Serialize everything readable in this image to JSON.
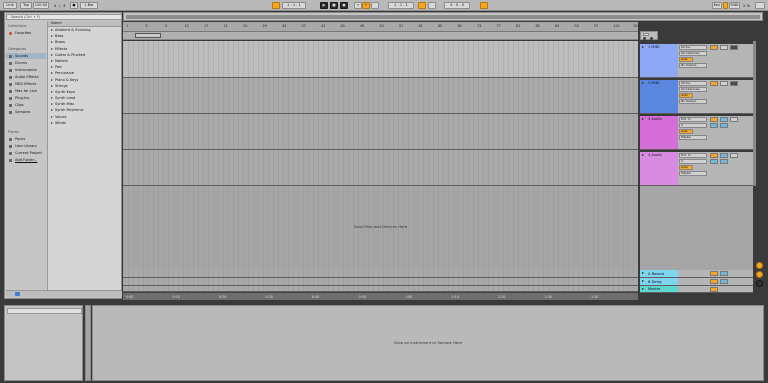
{
  "transport": {
    "link": "Link",
    "tap": "Tap",
    "tempo": "120.00",
    "meter_num": "4",
    "meter_den": "4",
    "metro": "1 Bar",
    "position": "1 . 1 . 1",
    "loop_start": "1 . 1 . 1",
    "loop_len": "4 . 0 . 0",
    "key": "Key",
    "midi": "MIDI",
    "cpu": "2 %",
    "accent": "#f5a623"
  },
  "browser": {
    "search_placeholder": "Search (Ctrl + F)",
    "collections_label": "Collections",
    "favorites": "Favorites",
    "categories_label": "Categories",
    "categories": [
      "Sounds",
      "Drums",
      "Instruments",
      "Audio Effects",
      "MIDI Effects",
      "Max for Live",
      "Plug-Ins",
      "Clips",
      "Samples"
    ],
    "places_label": "Places",
    "places": [
      "Packs",
      "User Library",
      "Current Project",
      "Add Folder..."
    ],
    "list_header": "Name",
    "items": [
      "Ambient & Evolving",
      "Bass",
      "Brass",
      "Effects",
      "Guitar & Plucked",
      "Mallets",
      "Pad",
      "Percussive",
      "Piano & Keys",
      "Strings",
      "Synth Keys",
      "Synth Lead",
      "Synth Misc",
      "Synth Rhythmic",
      "Voices",
      "Winds"
    ]
  },
  "ruler": {
    "bars": [
      "1",
      "5",
      "9",
      "13",
      "17",
      "21",
      "25",
      "29",
      "33",
      "37",
      "41",
      "45",
      "49",
      "53",
      "57",
      "61",
      "65",
      "69",
      "73",
      "77",
      "81",
      "85",
      "89",
      "93",
      "97",
      "101",
      "105"
    ]
  },
  "arrangement": {
    "drop_text": "Drop Files and Devices Here"
  },
  "tracks": [
    {
      "name": "1 MIDI",
      "color": "#8fa8f5",
      "io1": "All Ins",
      "io2": "All Channels",
      "io3": "Auto",
      "io4": "No Output"
    },
    {
      "name": "2 MIDI",
      "color": "#5a86e0",
      "io1": "All Ins",
      "io2": "All Channels",
      "io3": "Auto",
      "io4": "No Output"
    },
    {
      "name": "3 Audio",
      "color": "#d66ed8",
      "io1": "Ext. In",
      "io2": "1",
      "io3": "Auto",
      "io4": "Master"
    },
    {
      "name": "4 Audio",
      "color": "#d88be0",
      "io1": "Ext. In",
      "io2": "2",
      "io3": "Auto",
      "io4": "Master"
    }
  ],
  "returns": [
    {
      "name": "A Reverb",
      "color": "#7fd4f0"
    },
    {
      "name": "B Delay",
      "color": "#7fd4f0"
    },
    {
      "name": "Master",
      "color": "#5fd6cf"
    }
  ],
  "timeline": {
    "times": [
      "0:00",
      "0:10",
      "0:20",
      "0:30",
      "0:40",
      "0:50",
      "1:00",
      "1:10",
      "1:20",
      "1:30",
      "1:40"
    ]
  },
  "device": {
    "drop_text": "Drop an Instrument or Sample Here"
  }
}
